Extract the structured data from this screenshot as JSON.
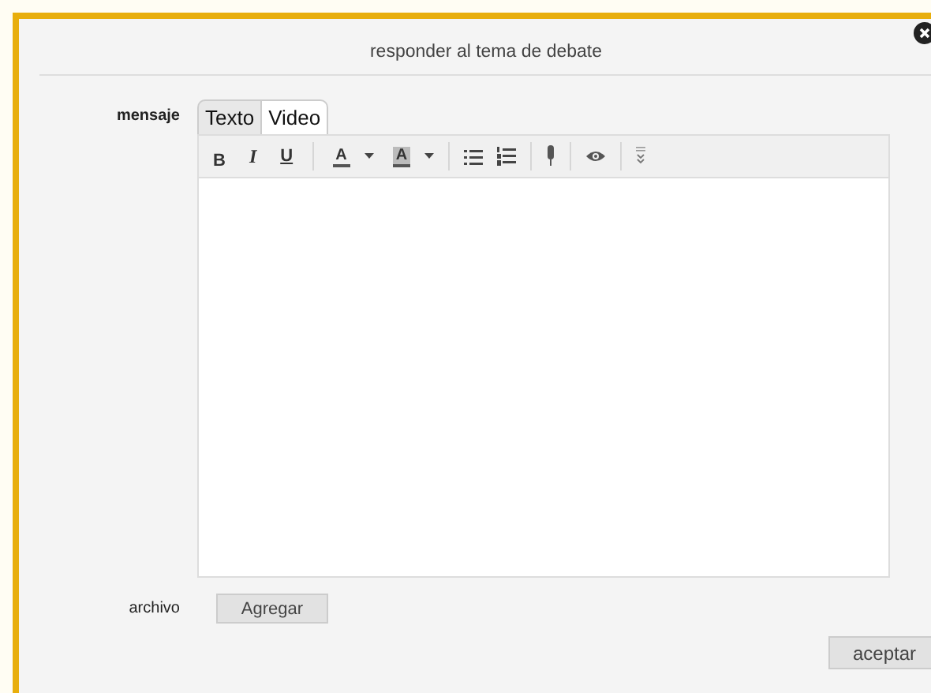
{
  "dialog": {
    "title": "responder al tema de debate"
  },
  "message": {
    "label": "mensaje",
    "tabs": [
      {
        "label": "Texto",
        "selected": true
      },
      {
        "label": "Video",
        "selected": false
      }
    ],
    "toolbar": [
      {
        "kind": "bold",
        "text": "B"
      },
      {
        "kind": "italic",
        "text": "I"
      },
      {
        "kind": "underline",
        "text": "U"
      },
      {
        "kind": "sep"
      },
      {
        "kind": "textcolor",
        "text": "A"
      },
      {
        "kind": "highlight",
        "text": "A"
      },
      {
        "kind": "sep"
      },
      {
        "kind": "bullets"
      },
      {
        "kind": "numbers"
      },
      {
        "kind": "sep"
      },
      {
        "kind": "mic"
      },
      {
        "kind": "sep"
      },
      {
        "kind": "eye"
      },
      {
        "kind": "sep"
      },
      {
        "kind": "more"
      }
    ]
  },
  "attachment": {
    "label": "archivo",
    "button": "Agregar"
  },
  "buttons": [
    "aceptar"
  ]
}
